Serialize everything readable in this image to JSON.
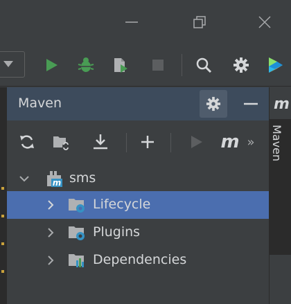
{
  "window": {
    "controls": [
      "minimize-icon",
      "restore-icon",
      "close-icon"
    ]
  },
  "toolbar": {
    "buttons": [
      "run-icon",
      "debug-icon",
      "coverage-icon",
      "stop-icon",
      "search-icon",
      "settings-icon",
      "plugin-logo-icon"
    ]
  },
  "maven_panel": {
    "title": "Maven",
    "toolbar_icons": [
      "reload-icon",
      "generate-sources-icon",
      "download-icon",
      "add-icon",
      "run-maven-goal-icon",
      "execute-maven-goal-icon",
      "more-icon"
    ],
    "maven_goal_glyph": "m",
    "overflow_glyph": "»",
    "tree": {
      "root": {
        "label": "sms",
        "expanded": true
      },
      "children": [
        {
          "label": "Lifecycle",
          "selected": true,
          "expanded": false
        },
        {
          "label": "Plugins",
          "selected": false,
          "expanded": false
        },
        {
          "label": "Dependencies",
          "selected": false,
          "expanded": false
        }
      ]
    }
  },
  "right_strip": {
    "icon_glyph": "m",
    "tab_label": "Maven"
  },
  "colors": {
    "background": "#3c3f41",
    "header_active": "#3d4b5c",
    "selection": "#4b6eaf",
    "run_green": "#499c54",
    "text": "#d5d7d9",
    "maven_blue": "#3592c4"
  }
}
